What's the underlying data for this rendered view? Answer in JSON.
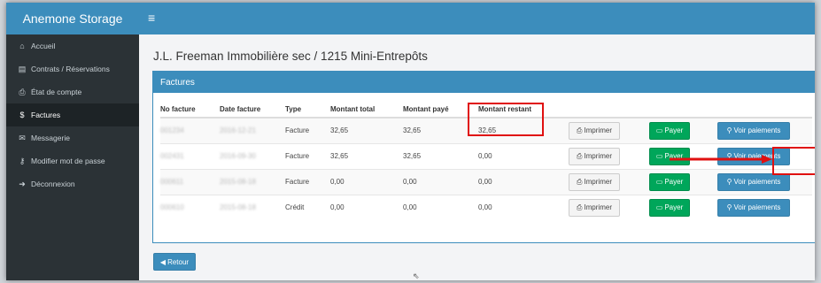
{
  "app": {
    "brand": "Anemone Storage"
  },
  "sidebar": {
    "items": [
      {
        "label": "Accueil",
        "icon": "home-icon",
        "glyph": "⌂"
      },
      {
        "label": "Contrats / Réservations",
        "icon": "file-icon",
        "glyph": "▤"
      },
      {
        "label": "État de compte",
        "icon": "print-icon",
        "glyph": "⎙"
      },
      {
        "label": "Factures",
        "icon": "dollar-icon",
        "glyph": "$",
        "active": true
      },
      {
        "label": "Messagerie",
        "icon": "envelope-icon",
        "glyph": "✉"
      },
      {
        "label": "Modifier mot de passe",
        "icon": "key-icon",
        "glyph": "⚷"
      },
      {
        "label": "Déconnexion",
        "icon": "sign-out-icon",
        "glyph": "➜"
      }
    ]
  },
  "header": {
    "menu_icon": "≡"
  },
  "page": {
    "title": "J.L. Freeman Immobilière sec / 1215 Mini-Entrepôts"
  },
  "panel": {
    "title": "Factures"
  },
  "table": {
    "headers": [
      "No facture",
      "Date facture",
      "Type",
      "Montant total",
      "Montant payé",
      "Montant restant"
    ],
    "rows": [
      {
        "no": "001234",
        "date": "2016-12-21",
        "type": "Facture",
        "total": "32,65",
        "paid": "32,65",
        "remaining": "32,65"
      },
      {
        "no": "002431",
        "date": "2016-09-30",
        "type": "Facture",
        "total": "32,65",
        "paid": "32,65",
        "remaining": "0,00"
      },
      {
        "no": "000611",
        "date": "2015-08-18",
        "type": "Facture",
        "total": "0,00",
        "paid": "0,00",
        "remaining": "0,00"
      },
      {
        "no": "000610",
        "date": "2015-08-18",
        "type": "Crédit",
        "total": "0,00",
        "paid": "0,00",
        "remaining": "0,00"
      }
    ]
  },
  "actions": {
    "print_label": "Imprimer",
    "pay_label": "Payer",
    "view_payments_label": "Voir paiements"
  },
  "footer": {
    "back_label": "Retour"
  },
  "colors": {
    "primary": "#3c8dbc",
    "success": "#00a65a",
    "sidebar": "#2b3236",
    "highlight": "#e01010"
  }
}
